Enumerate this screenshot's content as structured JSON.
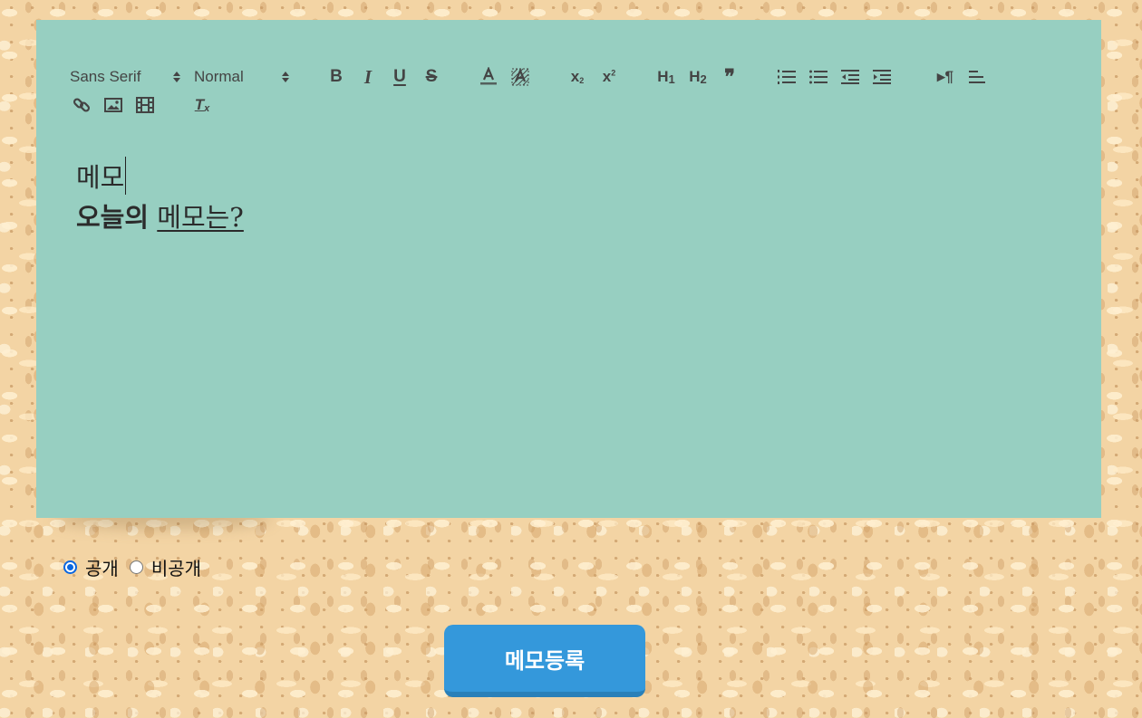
{
  "toolbar": {
    "font_picker": {
      "value": "Sans Serif"
    },
    "size_picker": {
      "value": "Normal"
    },
    "bold_label": "B",
    "italic_label": "I",
    "underline_label": "U",
    "strike_label": "S",
    "subscript_label": "x",
    "subscript_mark": "2",
    "superscript_label": "x",
    "superscript_mark": "2",
    "h1_label": "H",
    "h1_mark": "1",
    "h2_label": "H",
    "h2_mark": "2",
    "blockquote_label": "❞",
    "direction_label": "▸¶",
    "clean_label": "T",
    "clean_mark": "x",
    "icons": [
      "bold-icon",
      "italic-icon",
      "underline-icon",
      "strike-icon",
      "font-color-icon",
      "background-color-icon",
      "subscript-icon",
      "superscript-icon",
      "header-1-icon",
      "header-2-icon",
      "blockquote-icon",
      "ordered-list-icon",
      "bullet-list-icon",
      "outdent-icon",
      "indent-icon",
      "text-direction-icon",
      "align-icon",
      "link-icon",
      "image-icon",
      "video-icon",
      "clear-format-icon"
    ]
  },
  "editor": {
    "line1": "메모",
    "line2_bold": "오늘의",
    "line2_underline": "메모는?",
    "background": "#97cfc1"
  },
  "visibility": {
    "options": [
      {
        "label": "공개",
        "checked": true
      },
      {
        "label": "비공개",
        "checked": false
      }
    ]
  },
  "submit": {
    "label": "메모등록",
    "color": "#3498db"
  }
}
